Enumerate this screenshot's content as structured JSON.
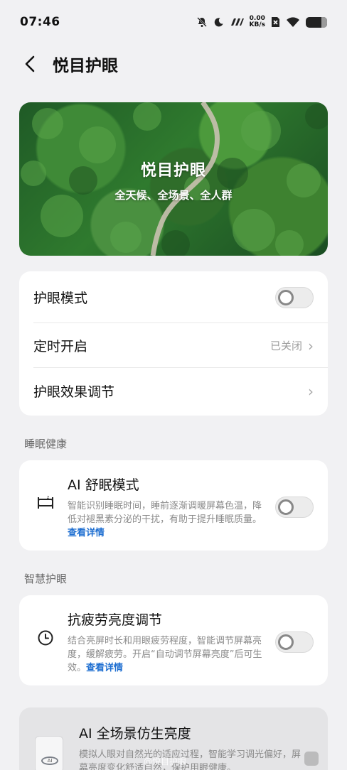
{
  "status_bar": {
    "time": "07:46",
    "net_speed_value": "0.00",
    "net_speed_unit": "KB/s",
    "icons": [
      "mute-icon",
      "moon-icon",
      "signal-speed-icon",
      "sim-off-icon",
      "wifi-icon",
      "battery-icon"
    ],
    "battery_level": 0.72
  },
  "header": {
    "title": "悦目护眼",
    "back_icon": "back-arrow-icon"
  },
  "banner": {
    "title": "悦目护眼",
    "subtitle": "全天候、全场景、全人群"
  },
  "settings": {
    "eye_care_mode": {
      "label": "护眼模式",
      "toggle_on": false
    },
    "schedule": {
      "label": "定时开启",
      "value": "已关闭"
    },
    "effect_adjust": {
      "label": "护眼效果调节"
    }
  },
  "section_sleep": {
    "label": "睡眠健康",
    "ai_sleep": {
      "title": "AI 舒眠模式",
      "description": "智能识别睡眠时间，睡前逐渐调暖屏幕色温，降低对褪黑素分泌的干扰，有助于提升睡眠质量。",
      "link": "查看详情",
      "toggle_on": false,
      "icon": "bed-icon"
    }
  },
  "section_smart": {
    "label": "智慧护眼",
    "anti_fatigue": {
      "title": "抗疲劳亮度调节",
      "description": "结合亮屏时长和用眼疲劳程度，智能调节屏幕亮度，缓解疲劳。开启“自动调节屏幕亮度”后可生效。",
      "link": "查看详情",
      "toggle_on": false,
      "icon": "clock-icon"
    },
    "ai_brightness": {
      "title": "AI 全场景仿生亮度",
      "description": "模拟人眼对自然光的适应过程，智能学习调光偏好，屏幕亮度变化舒适自然，保护用眼健康。",
      "icon_text": "AI"
    }
  },
  "watermark": "@悦目护眼"
}
